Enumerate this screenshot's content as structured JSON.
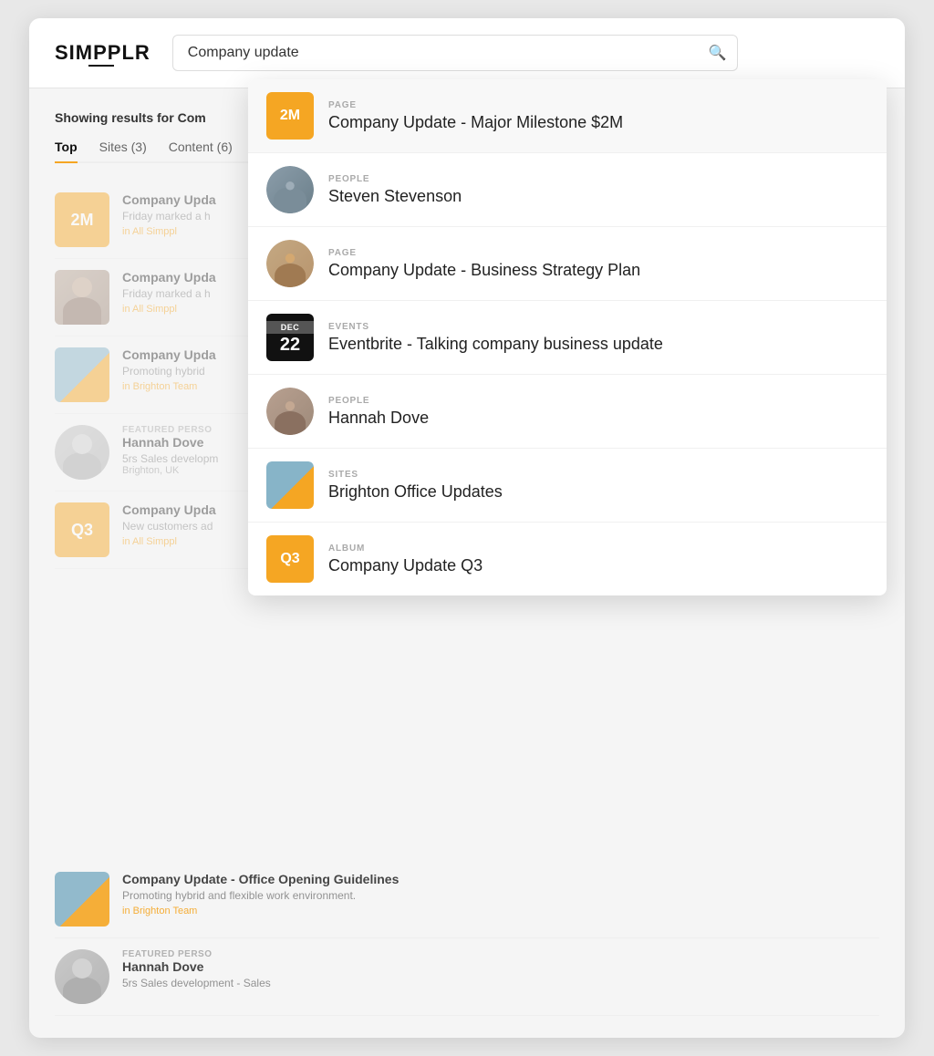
{
  "app": {
    "logo": "SIMPPLR"
  },
  "search": {
    "value": "Company update",
    "placeholder": "Company update"
  },
  "results_header": {
    "prefix": "Showing results for ",
    "query": "Com"
  },
  "tabs": [
    {
      "id": "top",
      "label": "Top",
      "active": true
    },
    {
      "id": "sites",
      "label": "Sites (3)",
      "active": false
    },
    {
      "id": "content",
      "label": "Content (6)",
      "active": false
    }
  ],
  "background_results": [
    {
      "id": 1,
      "thumb_type": "2m",
      "thumb_label": "2M",
      "title": "Company Upda",
      "desc": "Friday marked a h",
      "tag": "in All Simppl"
    },
    {
      "id": 2,
      "thumb_type": "person",
      "title": "Company Upda",
      "desc": "Friday marked a h",
      "tag": "in All Simppl"
    },
    {
      "id": 3,
      "thumb_type": "building",
      "title": "Company Upda",
      "desc": "Promoting hybrid",
      "tag": "in Brighton Team"
    },
    {
      "id": 4,
      "thumb_type": "avatar",
      "featured_label": "FEATURED PERSO",
      "title": "Hannah Dove",
      "desc": "5rs Sales developm",
      "meta": "Brighton, UK"
    },
    {
      "id": 5,
      "thumb_type": "q3",
      "thumb_label": "Q3",
      "title": "Company Upda",
      "desc": "New customers ad",
      "tag": "in All Simppl"
    }
  ],
  "extra_results": [
    {
      "id": 6,
      "thumb_type": "building",
      "title": "Company Update - Office Opening Guidelines",
      "desc": "Promoting hybrid and flexible work environment.",
      "tag": "in Brighton Team"
    },
    {
      "id": 7,
      "thumb_type": "avatar2",
      "featured_label": "FEATURED PERSO",
      "title": "Hannah Dove",
      "desc": "5rs Sales development - Sales",
      "meta": ""
    }
  ],
  "dropdown": {
    "items": [
      {
        "id": 1,
        "category": "PAGE",
        "title": "Company Update - Major Milestone $2M",
        "icon_type": "orange_text",
        "icon_label": "2M",
        "highlighted": true
      },
      {
        "id": 2,
        "category": "PEOPLE",
        "title": "Steven Stevenson",
        "icon_type": "person1",
        "highlighted": false
      },
      {
        "id": 3,
        "category": "PAGE",
        "title": "Company Update - Business Strategy Plan",
        "icon_type": "person2",
        "highlighted": false
      },
      {
        "id": 4,
        "category": "EVENTS",
        "title": "Eventbrite - Talking company business update",
        "icon_type": "event",
        "icon_month": "DEC",
        "icon_day": "22",
        "highlighted": false
      },
      {
        "id": 5,
        "category": "PEOPLE",
        "title": "Hannah Dove",
        "icon_type": "person3",
        "highlighted": false
      },
      {
        "id": 6,
        "category": "SITES",
        "title": "Brighton Office Updates",
        "icon_type": "sites",
        "highlighted": false
      },
      {
        "id": 7,
        "category": "ALBUM",
        "title": "Company Update Q3",
        "icon_type": "orange_text",
        "icon_label": "Q3",
        "highlighted": false
      }
    ]
  },
  "colors": {
    "orange": "#f5a623",
    "dark": "#111111",
    "tab_active_underline": "#f5a623"
  }
}
